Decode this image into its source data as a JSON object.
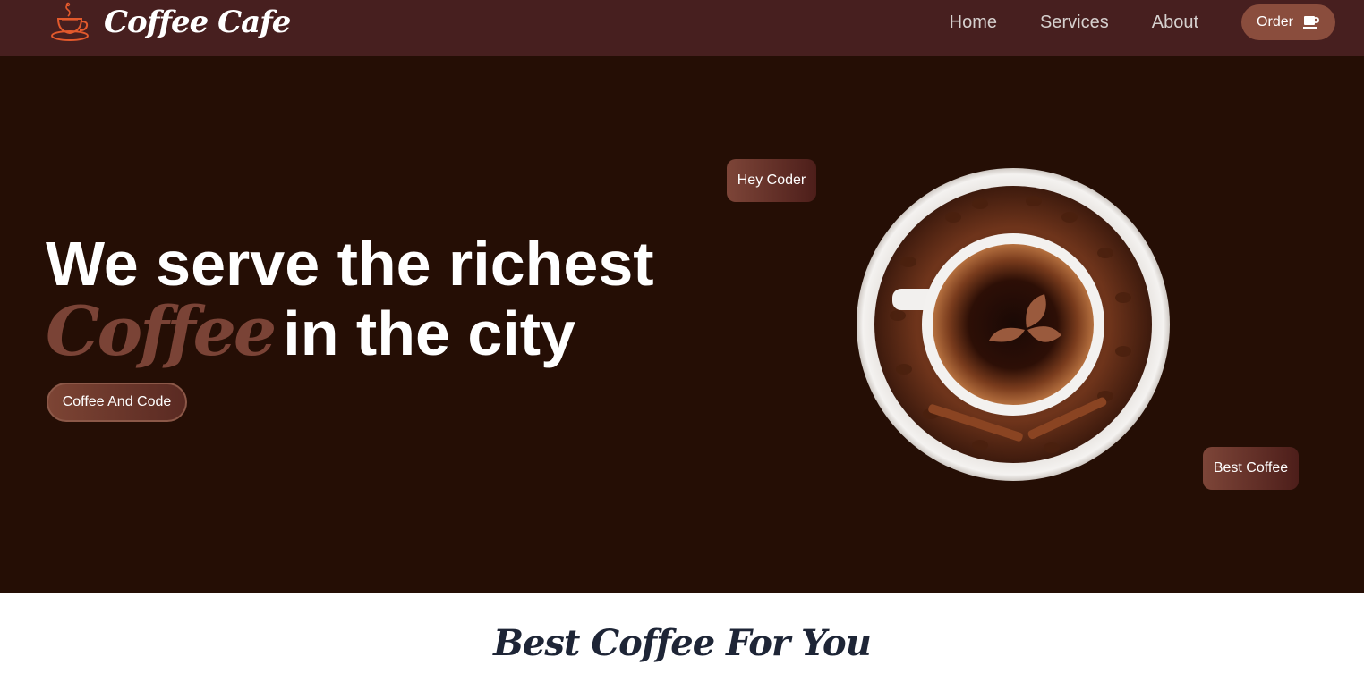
{
  "navbar": {
    "brand": "Coffee Cafe",
    "brand_icon": "coffee-cup-icon",
    "links": [
      "Home",
      "Services",
      "About"
    ],
    "order_label": "Order",
    "order_icon": "coffee-mug-icon"
  },
  "hero": {
    "line1": "We serve the richest",
    "coffee_word": "Coffee",
    "line2_rest": "in the city",
    "cta_label": "Coffee And Code",
    "badge_top": "Hey Coder",
    "badge_bottom": "Best Coffee",
    "image": "coffee-cup-on-beans-plate"
  },
  "section": {
    "title": "Best Coffee For You"
  },
  "colors": {
    "navbar": "#471f1f",
    "hero_bg": "#250e05",
    "accent": "#8a4d3d",
    "brand_icon": "#e2592c",
    "section_title": "#1e2536"
  }
}
